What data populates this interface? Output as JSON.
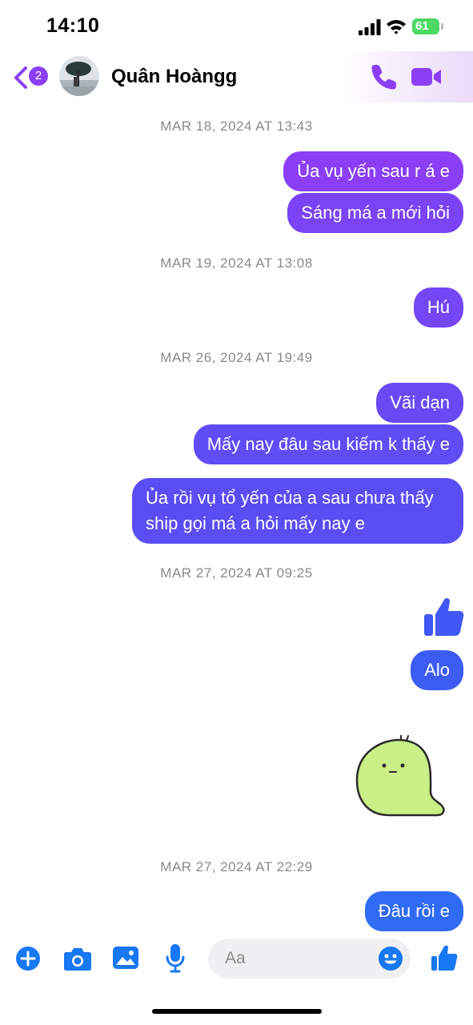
{
  "status_bar": {
    "time": "14:10",
    "battery": "61"
  },
  "header": {
    "back_badge": "2",
    "contact_name": "Quân Hoàngg",
    "icons": [
      "chevron-left-icon",
      "phone-icon",
      "video-camera-icon"
    ],
    "accent_color": "#8b3ff5"
  },
  "messages": {
    "ts1": "MAR 18, 2024 AT 13:43",
    "m1": "Ủa vụ yến sau r á e",
    "m2": "Sáng má a mới hỏi",
    "ts2": "MAR 19, 2024 AT 13:08",
    "m3": "Hú",
    "ts3": "MAR 26, 2024 AT 19:49",
    "m4": "Vãi dạn",
    "m5": "Mấy nay đâu sau kiếm k thấy e",
    "m6": "Ủa rồi vụ tổ yến của a sau chưa thấy ship gọi má a hỏi mấy nay e",
    "ts4": "MAR 27, 2024 AT 09:25",
    "m7_type": "thumbs-up",
    "m8": "Alo",
    "m9_type": "sticker",
    "ts5": "MAR 27, 2024 AT 22:29",
    "m10": "Đâu rồi e"
  },
  "bubble_colors": [
    "#8a3ff6",
    "#7a44f6",
    "#6a48f5",
    "#5a4cf4",
    "#4a58f4",
    "#2f6bf3"
  ],
  "composer": {
    "placeholder": "Aa",
    "icons": [
      "plus-icon",
      "camera-icon",
      "image-icon",
      "microphone-icon",
      "emoji-icon",
      "thumbs-up-icon"
    ],
    "accent_color": "#1877f2"
  }
}
